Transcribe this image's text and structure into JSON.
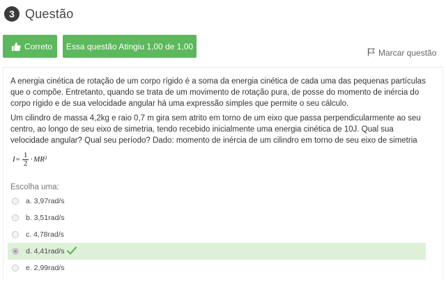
{
  "question": {
    "number": "3",
    "title": "Questão",
    "status_label": "Correto",
    "score_label": "Essa questão Atingiu 1,00 de 1,00",
    "flag_label": "Marcar questão"
  },
  "body": {
    "paragraph1": "A energia cinética de rotação de um corpo rígido é a soma da energia cinética de cada uma das pequenas partículas que o compõe. Entretanto, quando se trata de um movimento de rotação pura, de posse do momento de inércia do corpo rígido e de sua velocidade angular há uma expressão simples que permite o seu cálculo.",
    "paragraph2": "Um cilindro de massa 4,2kg e raio 0,7 m gira sem atrito em torno de um eixo que passa perpendicularmente ao seu centro, ao longo de seu eixo de simetria, tendo recebido inicialmente uma energia cinética de 10J. Qual sua velocidade angular? Qual seu período? Dado: momento de inércia de um cilindro em torno de seu eixo de simetria",
    "formula": {
      "lhs": "I",
      "equals": "=",
      "numerator": "1",
      "denominator": "2",
      "dot": "·",
      "rhs": "MR",
      "exponent": "2"
    }
  },
  "choices": {
    "prompt": "Escolha uma:",
    "options": [
      {
        "label": "a. 3,97rad/s",
        "selected": false,
        "correct": false
      },
      {
        "label": "b. 3,51rad/s",
        "selected": false,
        "correct": false
      },
      {
        "label": "c. 4,78rad/s",
        "selected": false,
        "correct": false
      },
      {
        "label": "d. 4,41rad/s",
        "selected": true,
        "correct": true
      },
      {
        "label": "e. 2,99rad/s",
        "selected": false,
        "correct": false
      }
    ]
  },
  "icons": {
    "status": "thumbs-up-icon",
    "flag": "flag-icon",
    "correct_mark": "checkmark-icon"
  },
  "colors": {
    "success": "#5cb85c",
    "correct_row_bg": "#dff0d8",
    "check": "#5cb85c",
    "badge": "#3a3a3a"
  }
}
